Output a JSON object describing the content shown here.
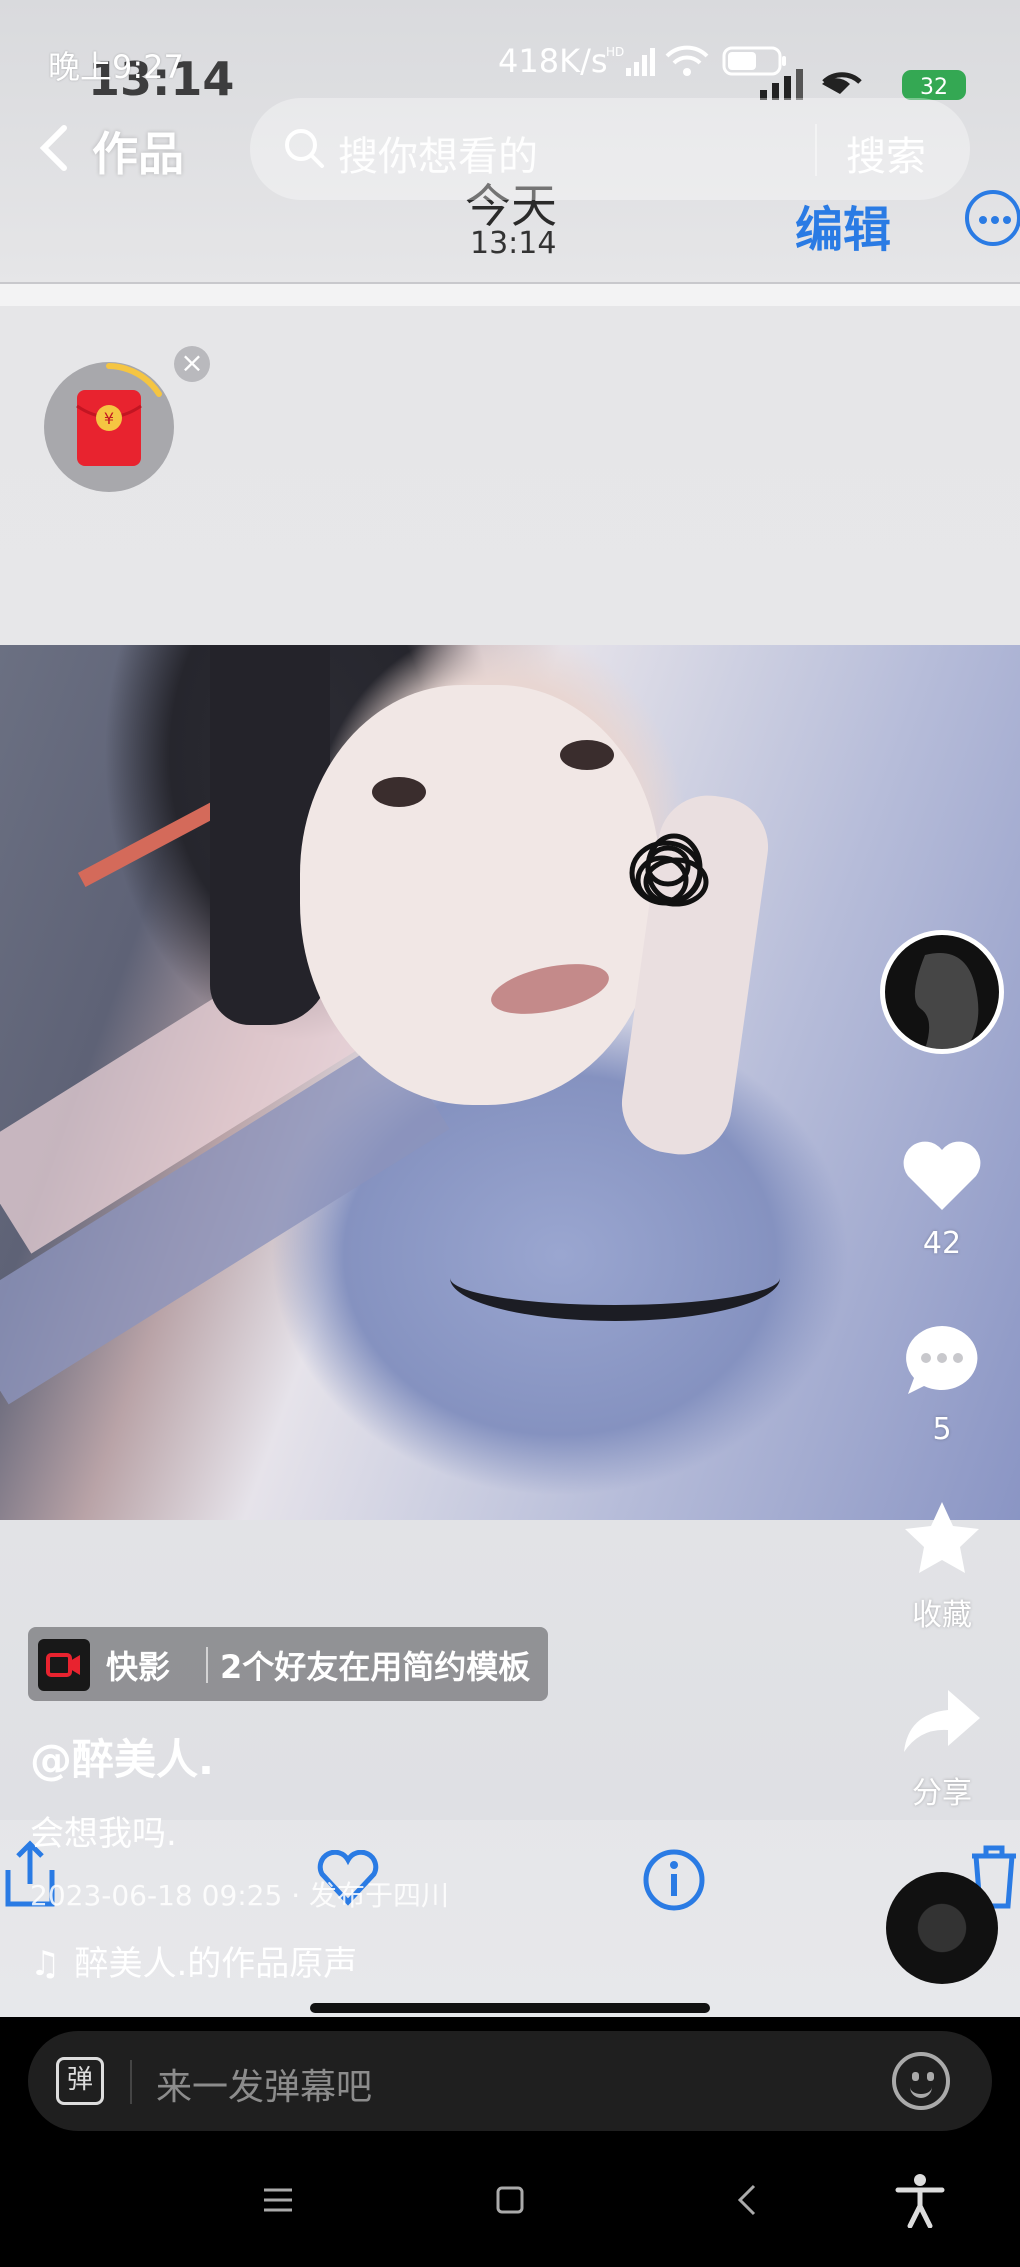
{
  "status_bar": {
    "time": "晚上9:27",
    "speed": "418K/s",
    "battery": ""
  },
  "inner_status": {
    "time": "13:14",
    "battery": "32"
  },
  "nav": {
    "title": "作品",
    "search_placeholder": "搜你想看的",
    "search_button": "搜索"
  },
  "inner_header": {
    "day": "今天",
    "time": "13:14",
    "edit": "编辑"
  },
  "red_packet": {
    "symbol": "¥"
  },
  "side_actions": {
    "likes": "42",
    "comments": "5",
    "collect": "收藏",
    "share": "分享"
  },
  "template": {
    "app": "快影",
    "text": "2个好友在用简约模板"
  },
  "post": {
    "author": "@醉美人.",
    "caption": "会想我吗.",
    "datetime": "2023-06-18 09:25",
    "location": "发布于四川",
    "music": "醉美人.的作品原声"
  },
  "danmu": {
    "icon": "弹",
    "placeholder": "来一发弹幕吧"
  },
  "colors": {
    "accent_blue": "#2a7be4",
    "red_packet": "#e8232f"
  }
}
